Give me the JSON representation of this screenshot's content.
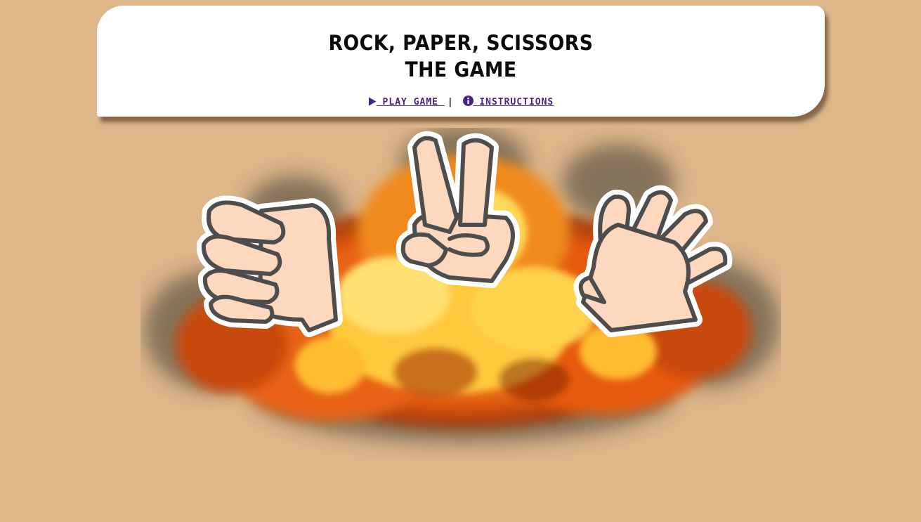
{
  "colors": {
    "background": "#ddb68a",
    "link": "#4a1f8a",
    "hand_fill": "#fcd8bf",
    "hand_outline": "#4d4d4d"
  },
  "header": {
    "title_line1": "ROCK, PAPER, SCISSORS",
    "title_line2": "THE GAME"
  },
  "nav": {
    "play_label": " PLAY GAME",
    "play_icon": "play-icon",
    "separator": "|",
    "instructions_label": " INSTRUCTIONS",
    "instructions_icon": "info-icon"
  },
  "hero": {
    "hands": [
      "rock",
      "scissors",
      "paper"
    ],
    "background_effect": "fire-explosion"
  }
}
